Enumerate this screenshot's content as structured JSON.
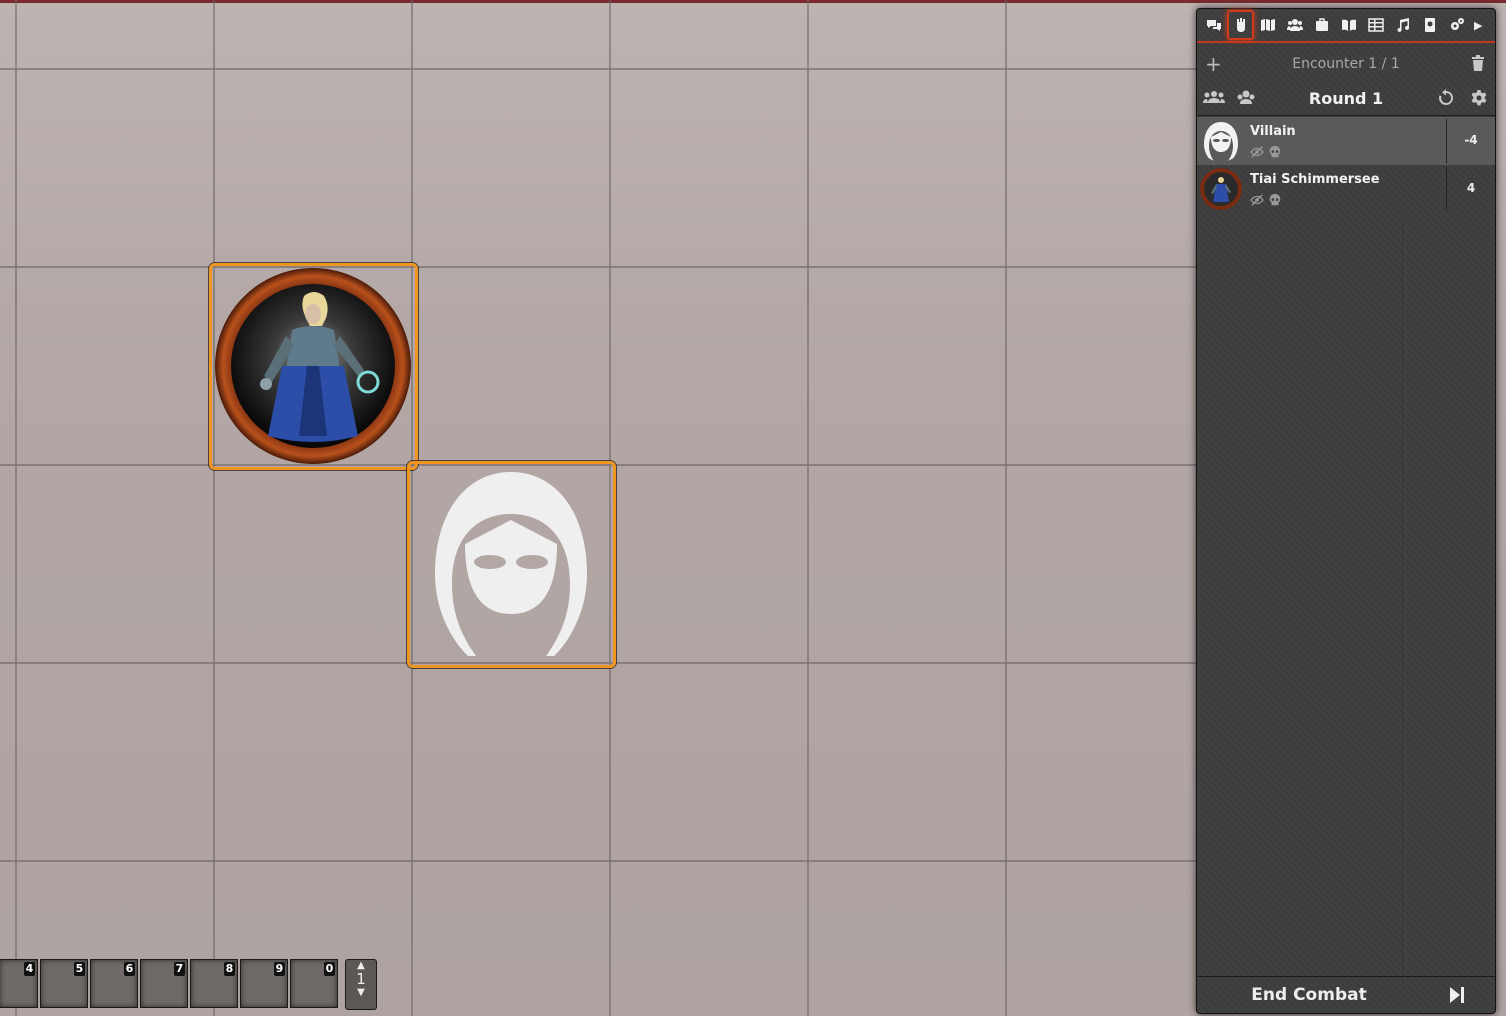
{
  "hotbar": {
    "slots": [
      "4",
      "5",
      "6",
      "7",
      "8",
      "9",
      "0"
    ],
    "page": "1"
  },
  "sidebar": {
    "tabs": [
      "chat-icon",
      "combat-icon",
      "scenes-icon",
      "actors-icon",
      "items-icon",
      "journal-icon",
      "tables-icon",
      "playlists-icon",
      "compendium-icon",
      "settings-icon"
    ],
    "active_tab": "combat-icon",
    "encounter_title": "Encounter 1 / 1",
    "round_title": "Round 1",
    "combatants": [
      {
        "name": "Villain",
        "initiative": "-4"
      },
      {
        "name": "Tiai Schimmersee",
        "initiative": "4"
      }
    ],
    "end_combat_label": "End Combat"
  },
  "colors": {
    "token_border": "#f0951f",
    "active_tab": "#d23a1c",
    "sidebar_bg": "#3d3d3d"
  }
}
